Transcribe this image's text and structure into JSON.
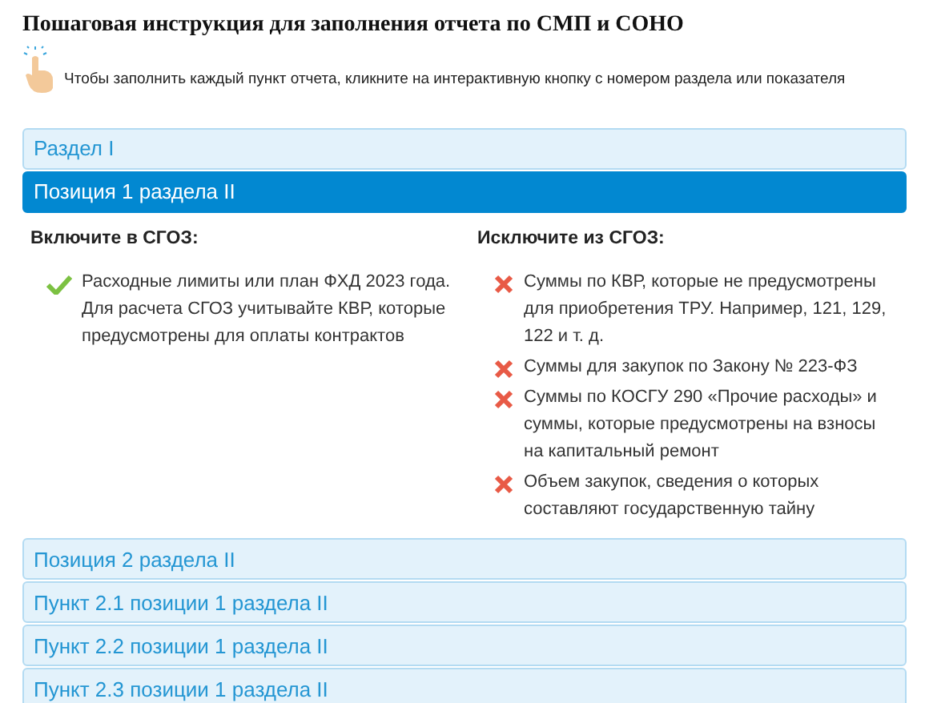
{
  "title": "Пошаговая инструкция для заполнения отчета по СМП и СОНО",
  "hint": "Чтобы заполнить каждый пункт отчета, кликните на интерактивную кнопку с номером раздела или показателя",
  "accordion": [
    {
      "label": "Раздел I",
      "expanded": false
    },
    {
      "label": "Позиция 1 раздела II",
      "expanded": true,
      "panel": {
        "columns": [
          {
            "heading": "Включите в СГОЗ:",
            "items": [
              {
                "kind": "include",
                "text": "Расходные лимиты или план ФХД 2023 года. Для расчета СГОЗ учитывайте КВР, которые предусмотрены для оплаты контрактов"
              }
            ]
          },
          {
            "heading": "Исключите из СГОЗ:",
            "items": [
              {
                "kind": "exclude",
                "text": "Суммы по КВР, которые не предусмотрены для приобретения ТРУ. Например, 121, 129, 122 и т. д."
              },
              {
                "kind": "exclude",
                "text": "Суммы для закупок по Закону № 223-ФЗ"
              },
              {
                "kind": "exclude",
                "text": "Суммы по КОСГУ 290 «Прочие расходы» и суммы, которые предусмотрены на взносы на капитальный ремонт"
              },
              {
                "kind": "exclude",
                "text": "Объем закупок, сведения о которых составляют государственную тайну"
              }
            ]
          }
        ]
      }
    },
    {
      "label": "Позиция 2 раздела II",
      "expanded": false
    },
    {
      "label": "Пункт 2.1 позиции 1 раздела II",
      "expanded": false
    },
    {
      "label": "Пункт 2.2 позиции 1 раздела II",
      "expanded": false
    },
    {
      "label": "Пункт 2.3 позиции 1 раздела II",
      "expanded": false
    }
  ]
}
